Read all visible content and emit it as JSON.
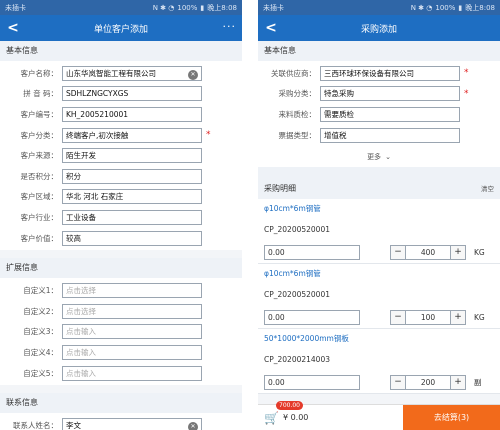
{
  "status_bar": {
    "carrier": "未插卡 ",
    "battery": "100%",
    "time": "晚上8:08"
  },
  "left": {
    "nav": {
      "title": "单位客户添加",
      "more": "···",
      "back": "<"
    },
    "basic": {
      "title": "基本信息",
      "fields": [
        {
          "label": "客户名称：",
          "value": "山东华岚智能工程有限公司",
          "clear": true
        },
        {
          "label": "拼 音 码：",
          "value": "SDHLZNGCYXGS"
        },
        {
          "label": "客户编号：",
          "value": "KH_2005210001"
        },
        {
          "label": "客户分类：",
          "value": "终端客户,初次接触",
          "required": "*"
        },
        {
          "label": "客户来源：",
          "value": "陌生开发"
        },
        {
          "label": "是否积分：",
          "value": "积分"
        },
        {
          "label": "客户区域：",
          "value": "华北 河北 石家庄"
        },
        {
          "label": "客户行业：",
          "value": "工业设备"
        },
        {
          "label": "客户价值：",
          "value": "较高"
        }
      ]
    },
    "ext": {
      "title": "扩展信息",
      "fields": [
        {
          "label": "自定义1：",
          "placeholder": "点击选择"
        },
        {
          "label": "自定义2：",
          "placeholder": "点击选择"
        },
        {
          "label": "自定义3：",
          "placeholder": "点击输入"
        },
        {
          "label": "自定义4：",
          "placeholder": "点击输入"
        },
        {
          "label": "自定义5：",
          "placeholder": "点击输入"
        }
      ]
    },
    "contact": {
      "title": "联系信息",
      "fields": [
        {
          "label": "联系人姓名：",
          "value": "李文",
          "clear": true
        }
      ]
    }
  },
  "right": {
    "nav": {
      "title": "采购添加",
      "back": "<"
    },
    "basic": {
      "title": "基本信息",
      "fields": [
        {
          "label": "关联供应商：",
          "value": "三西环球环保设备有限公司",
          "required": "*"
        },
        {
          "label": "采购分类：",
          "value": "特急采购",
          "required": "*"
        },
        {
          "label": "来料质检：",
          "value": "需要质检"
        },
        {
          "label": "票据类型：",
          "value": "增值税"
        }
      ],
      "more": "更多"
    },
    "detail": {
      "title": "采购明细",
      "clear": "清空",
      "items": [
        {
          "name": "φ10cm*6m钢管",
          "code": "CP_20200520001",
          "price": "0.00",
          "qty": "400",
          "unit": "KG"
        },
        {
          "name": "φ10cm*6m钢管",
          "code": "CP_20200520001",
          "price": "0.00",
          "qty": "100",
          "unit": "KG"
        },
        {
          "name": "50*1000*2000mm钢板",
          "code": "CP_20200214003",
          "price": "0.00",
          "qty": "200",
          "unit": "副"
        }
      ]
    },
    "bottom": {
      "badge": "700.00",
      "total": "¥ 0.00",
      "checkout": "去结算(3)"
    }
  }
}
